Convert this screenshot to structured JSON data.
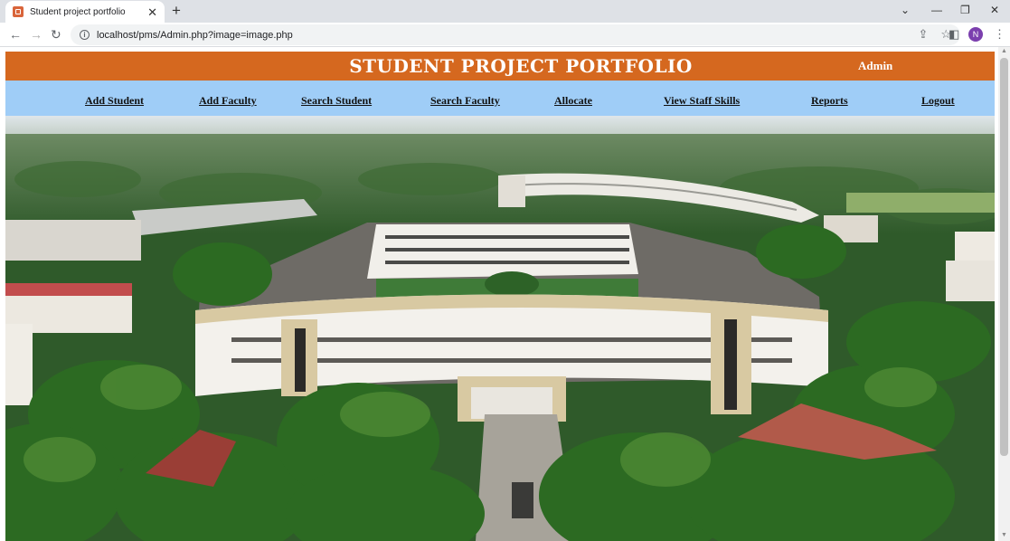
{
  "browser": {
    "tab_title": "Student project portfolio",
    "url": "localhost/pms/Admin.php?image=image.php",
    "profile_initial": "N"
  },
  "header": {
    "title": "STUDENT PROJECT PORTFOLIO",
    "user": "Admin"
  },
  "menu": [
    {
      "label": "Add Student"
    },
    {
      "label": "Add Faculty"
    },
    {
      "label": "Search Student"
    },
    {
      "label": "Search Faculty"
    },
    {
      "label": "Allocate"
    },
    {
      "label": "View Staff Skills"
    },
    {
      "label": "Reports"
    },
    {
      "label": "Logout"
    }
  ],
  "colors": {
    "header_bg": "#d5681f",
    "menu_bg": "#9fcdf7"
  }
}
